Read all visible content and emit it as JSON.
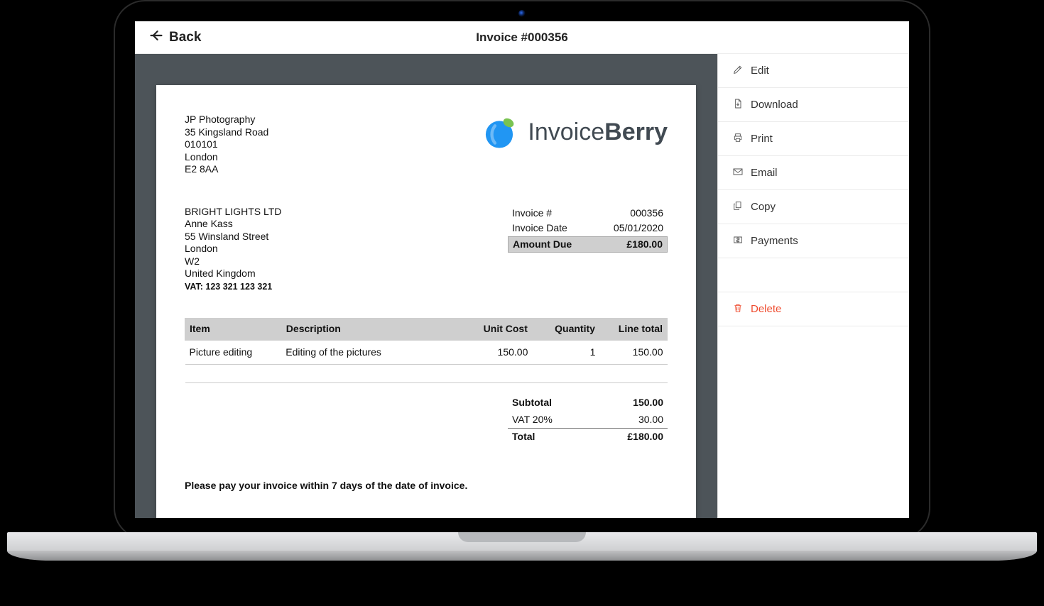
{
  "topbar": {
    "back_label": "Back",
    "title": "Invoice #000356"
  },
  "brand": {
    "name_part1": "Invoice",
    "name_part2": "Berry"
  },
  "from": {
    "name": "JP Photography",
    "street": "35 Kingsland Road",
    "code": "010101",
    "city": "London",
    "postcode": "E2 8AA"
  },
  "bill_to": {
    "company": "BRIGHT LIGHTS LTD",
    "contact": "Anne Kass",
    "street": "55 Winsland Street",
    "city": "London",
    "postcode": "W2",
    "country": "United Kingdom",
    "vat_label": "VAT: 123 321 123 321"
  },
  "meta": {
    "number_label": "Invoice #",
    "number_value": "000356",
    "date_label": "Invoice Date",
    "date_value": "05/01/2020",
    "due_label": "Amount Due",
    "due_value": "£180.00"
  },
  "columns": {
    "item": "Item",
    "description": "Description",
    "unit_cost": "Unit Cost",
    "quantity": "Quantity",
    "line_total": "Line total"
  },
  "line_items": [
    {
      "item": "Picture editing",
      "description": "Editing of the pictures",
      "unit_cost": "150.00",
      "quantity": "1",
      "line_total": "150.00"
    }
  ],
  "totals": {
    "subtotal_label": "Subtotal",
    "subtotal_value": "150.00",
    "vat_label": "VAT 20%",
    "vat_value": "30.00",
    "total_label": "Total",
    "total_value": "£180.00"
  },
  "note": "Please pay your invoice within 7 days of the date of invoice.",
  "actions": {
    "edit": "Edit",
    "download": "Download",
    "print": "Print",
    "email": "Email",
    "copy": "Copy",
    "payments": "Payments",
    "delete": "Delete"
  }
}
